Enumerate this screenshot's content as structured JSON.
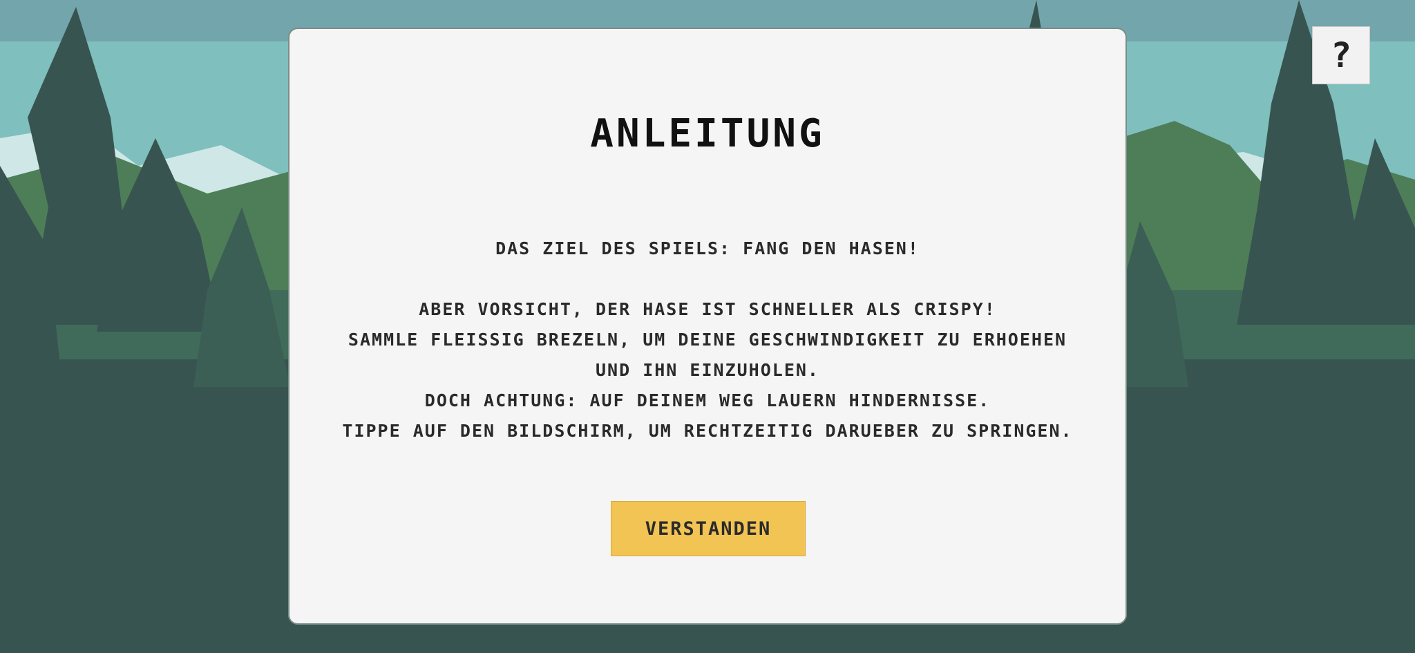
{
  "help": {
    "icon": "question-icon",
    "glyph": "?"
  },
  "dialog": {
    "title": "Anleitung",
    "goal": "Das Ziel des Spiels: Fang den Hasen!",
    "lines": [
      "Aber Vorsicht, der Hase ist schneller als Crispy!",
      "Sammle fleissig Brezeln, um deine Geschwindigkeit zu erhoehen und ihn einzuholen.",
      "Doch Achtung: Auf deinem Weg lauern Hindernisse.",
      "Tippe auf den Bildschirm, um rechtzeitig darueber zu springen."
    ],
    "confirm_label": "Verstanden"
  },
  "colors": {
    "sky": "#7fbfbe",
    "tree_dark": "#385450",
    "hill": "#4e7e58",
    "panel": "#f5f5f5",
    "button": "#f2c454"
  }
}
